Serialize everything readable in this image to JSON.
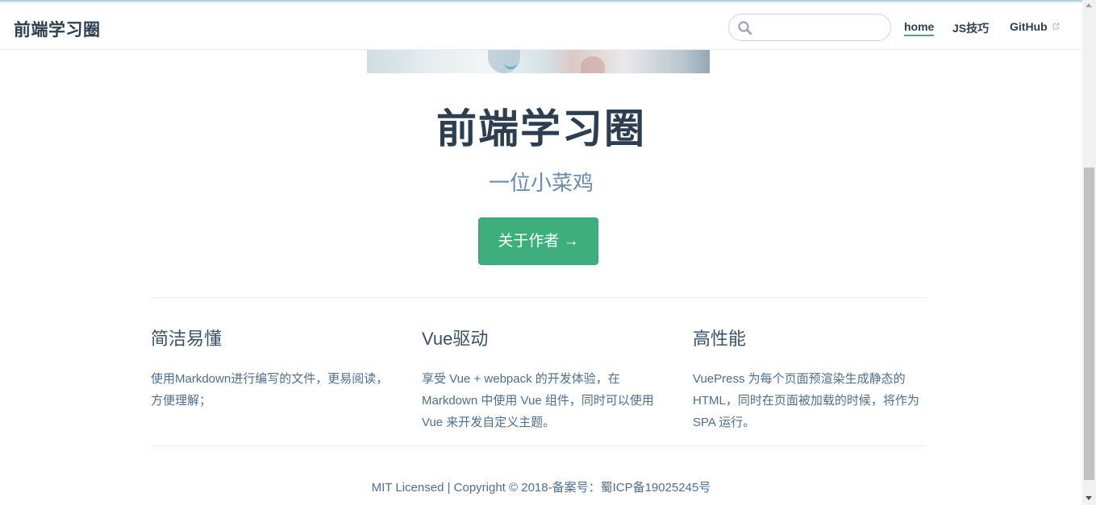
{
  "navbar": {
    "site_name": "前端学习圈",
    "search": {
      "value": "",
      "placeholder": ""
    },
    "links": [
      {
        "label": "home",
        "active": true
      },
      {
        "label": "JS技巧",
        "active": false
      },
      {
        "label": "GitHub",
        "external": true
      }
    ]
  },
  "hero": {
    "title": "前端学习圈",
    "description": "一位小菜鸡",
    "action_label": "关于作者 →"
  },
  "features": [
    {
      "title": "简洁易懂",
      "details": "使用Markdown进行编写的文件，更易阅读，方便理解；"
    },
    {
      "title": "Vue驱动",
      "details": "享受 Vue + webpack 的开发体验，在 Markdown 中使用 Vue 组件，同时可以使用 Vue 来开发自定义主题。"
    },
    {
      "title": "高性能",
      "details": "VuePress 为每个页面预渲染生成静态的 HTML，同时在页面被加载的时候，将作为 SPA 运行。"
    }
  ],
  "footer": {
    "text": "MIT Licensed | Copyright © 2018-备案号：蜀ICP备19025245号"
  },
  "colors": {
    "accent": "#3eaf7c",
    "text": "#2c3e50",
    "muted": "#6a8bad"
  },
  "icons": {
    "search": "search-icon",
    "external": "external-link-icon"
  }
}
